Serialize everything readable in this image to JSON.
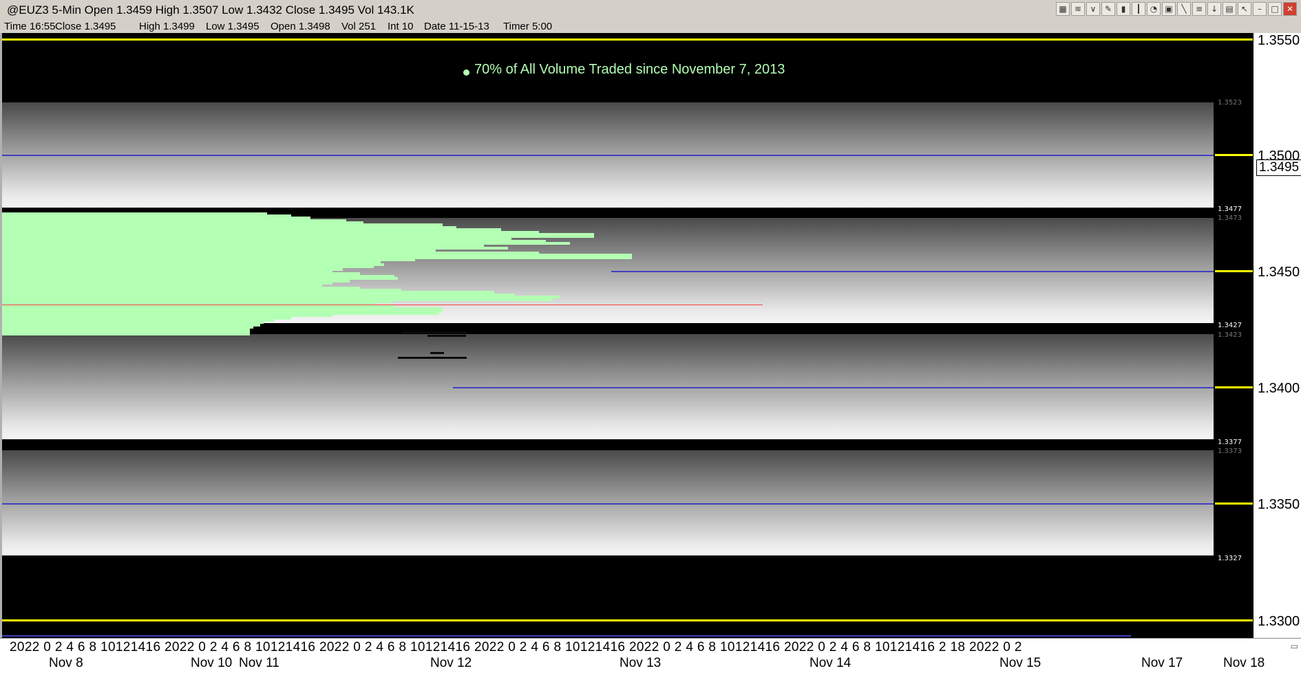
{
  "window": {
    "title": "@EUZ3 5-Min Open 1.3459 High 1.3507 Low 1.3432 Close 1.3495 Vol 143.1K",
    "toolbar_icons": [
      "chart-icon",
      "indicator-icon",
      "analysis-icon",
      "drawing-icon",
      "bar-chart-icon",
      "candle-icon",
      "clock-icon",
      "data-window-icon",
      "pen-icon",
      "fib-icon",
      "down-arrow-icon",
      "delete-icon",
      "cursor-icon",
      "minimize-icon",
      "maximize-icon",
      "close-icon"
    ]
  },
  "status": {
    "time": "Time 16:55",
    "close": "Close 1.3495",
    "high": "High 1.3499",
    "low": "Low 1.3495",
    "open": "Open 1.3498",
    "vol": "Vol 251",
    "int": "Int 10",
    "date": "Date 11-15-13",
    "timer": "Timer 5:00"
  },
  "annotation": "70% of All Volume Traded since November 7, 2013",
  "colors": {
    "volume": "#b3ffb3",
    "level_line": "#4040c0",
    "yellow_line": "#ffff00",
    "poc_line": "#ff4040",
    "background": "#000000"
  },
  "band_labels": [
    "1.3523",
    "1.3477",
    "1.3473",
    "1.3427",
    "1.3423",
    "1.3377",
    "1.3373",
    "1.3327"
  ],
  "y_axis": {
    "labels": [
      "1.3550",
      "1.3500",
      "1.3450",
      "1.3400",
      "1.3350",
      "1.3300"
    ],
    "current_price": "1.3495",
    "range": [
      1.329,
      1.356
    ]
  },
  "x_axis": {
    "hour_labels": "2022 0 2 4 6 8 10121416 2022 0 2 4 6 8 10121416 2022 0 2 4 6 8 10121416 2022 0 2 4 6 8 10121416 2022 0 2 4 6 8 10121416 2022 0 2 4 6 8 10121416 2 18 2022 0 2",
    "dates": [
      "Nov 8",
      "Nov 10",
      "Nov 11",
      "Nov 12",
      "Nov 13",
      "Nov 14",
      "Nov 15",
      "Nov 17",
      "Nov 18"
    ]
  },
  "volume_profile": {
    "price_step": 0.0001,
    "top_price": 1.3475,
    "poc_price": 1.3436,
    "widths": [
      385,
      420,
      448,
      500,
      525,
      640,
      660,
      725,
      780,
      860,
      860,
      740,
      790,
      825,
      700,
      735,
      630,
      780,
      915,
      915,
      600,
      550,
      555,
      540,
      495,
      480,
      520,
      570,
      575,
      505,
      480,
      465,
      520,
      580,
      715,
      745,
      810,
      800,
      565,
      540,
      570,
      640,
      640,
      635,
      480,
      420,
      395,
      380,
      375,
      365,
      360,
      360,
      360
    ]
  }
}
